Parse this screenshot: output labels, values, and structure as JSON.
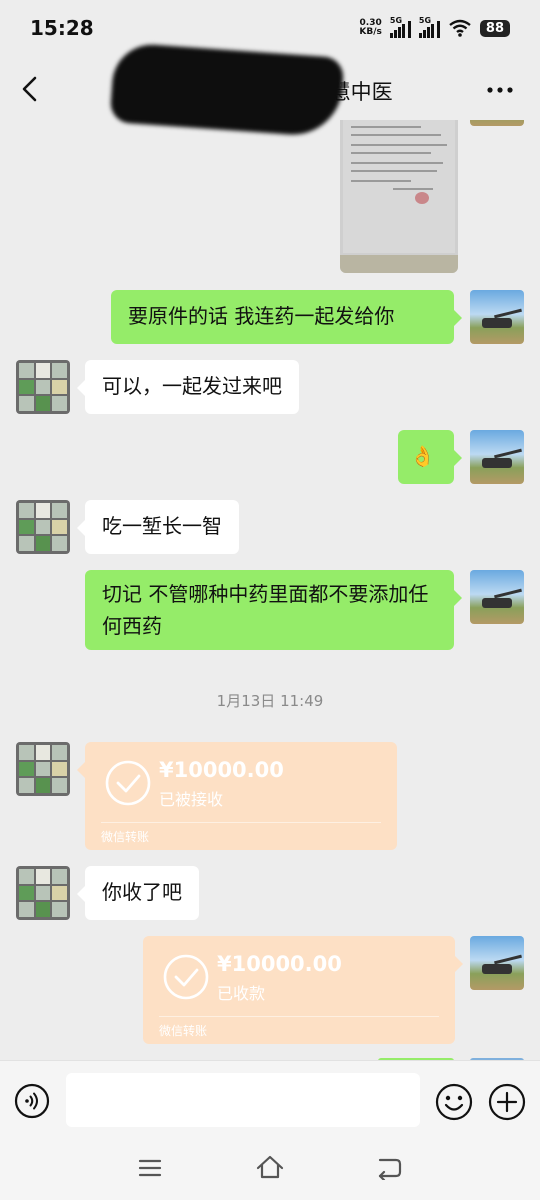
{
  "status_bar": {
    "time": "15:28",
    "net_speed_value": "0.30",
    "net_speed_unit": "KB/s",
    "sim1": "5G",
    "sim2": "5G",
    "battery": "88"
  },
  "header": {
    "title": "A张氏中医门诊张敏慧中医",
    "back_icon": "chevron-left-icon",
    "more_icon": "more-dots-icon"
  },
  "messages": [
    {
      "type": "image",
      "direction": "sent",
      "icon": "document-photo"
    },
    {
      "type": "text",
      "direction": "sent",
      "text": "要原件的话  我连药一起发给你"
    },
    {
      "type": "text",
      "direction": "received",
      "text": "可以，一起发过来吧"
    },
    {
      "type": "emoji",
      "direction": "sent",
      "text": "👌"
    },
    {
      "type": "text",
      "direction": "received",
      "text": "吃一堑长一智"
    },
    {
      "type": "text",
      "direction": "sent",
      "text": "切记  不管哪种中药里面都不要添加任何西药"
    }
  ],
  "timestamp": "1月13日 11:49",
  "transfers": [
    {
      "direction": "received",
      "amount": "¥10000.00",
      "status": "已被接收",
      "label": "微信转账"
    },
    {
      "direction": "sent",
      "amount": "¥10000.00",
      "status": "已收款",
      "label": "微信转账"
    }
  ],
  "message_after_first_transfer": {
    "direction": "received",
    "text": "你收了吧"
  },
  "input_bar": {
    "voice_icon": "voice-icon",
    "placeholder": "",
    "emoji_icon": "emoji-icon",
    "plus_icon": "plus-icon"
  },
  "colors": {
    "sent_bubble": "#95ec69",
    "received_bubble": "#ffffff",
    "transfer_card": "#fde0c5",
    "background": "#ededed"
  }
}
